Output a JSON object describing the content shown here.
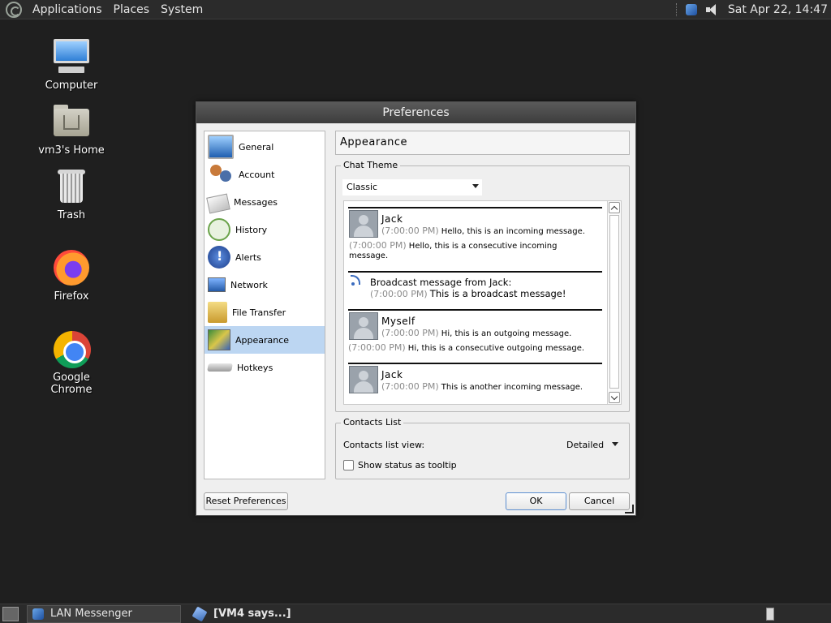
{
  "top_panel": {
    "menus": [
      "Applications",
      "Places",
      "System"
    ],
    "clock": "Sat Apr 22, 14:47"
  },
  "desktop_icons": [
    {
      "label": "Computer",
      "icon": "computer-icon"
    },
    {
      "label": "vm3's Home",
      "icon": "home-folder-icon"
    },
    {
      "label": "Trash",
      "icon": "trash-icon"
    },
    {
      "label": "Firefox",
      "icon": "firefox-icon"
    },
    {
      "label": "Google Chrome",
      "icon": "chrome-icon"
    }
  ],
  "dialog": {
    "title": "Preferences",
    "sidebar": [
      {
        "label": "General",
        "icon": "monitor-icon"
      },
      {
        "label": "Account",
        "icon": "users-icon"
      },
      {
        "label": "Messages",
        "icon": "envelope-icon"
      },
      {
        "label": "History",
        "icon": "clock-icon"
      },
      {
        "label": "Alerts",
        "icon": "info-icon"
      },
      {
        "label": "Network",
        "icon": "network-icon"
      },
      {
        "label": "File Transfer",
        "icon": "folder-arrow-icon"
      },
      {
        "label": "Appearance",
        "icon": "appearance-icon",
        "selected": true
      },
      {
        "label": "Hotkeys",
        "icon": "keyboard-icon"
      }
    ],
    "page_title": "Appearance",
    "chat_theme": {
      "group_label": "Chat Theme",
      "selected": "Classic",
      "preview": {
        "jack1_name": "Jack",
        "jack1_time": "(7:00:00 PM)",
        "jack1_text": "Hello, this is an incoming message.",
        "jack1b_time": "(7:00:00 PM)",
        "jack1b_text": "Hello, this is a consecutive incoming",
        "jack1b_text2": "message.",
        "bc_title": "Broadcast message from Jack:",
        "bc_time": "(7:00:00 PM)",
        "bc_text": "This is a broadcast message!",
        "me_name": "Myself",
        "me_time": "(7:00:00 PM)",
        "me_text": "Hi, this is an outgoing message.",
        "me2_time": "(7:00:00 PM)",
        "me2_text": "Hi, this is a consecutive outgoing message.",
        "jack2_name": "Jack",
        "jack2_time": "(7:00:00 PM)",
        "jack2_text": "This is another incoming message."
      }
    },
    "contacts_list": {
      "group_label": "Contacts List",
      "view_label": "Contacts list view:",
      "view_value": "Detailed",
      "tooltip_label": "Show status as tooltip",
      "tooltip_checked": false
    },
    "buttons": {
      "reset": "Reset Preferences",
      "ok": "OK",
      "cancel": "Cancel"
    }
  },
  "taskbar": {
    "tasks": [
      {
        "label": "LAN Messenger",
        "active": true
      },
      {
        "label": "[VM4 says...]",
        "active": false
      }
    ]
  }
}
